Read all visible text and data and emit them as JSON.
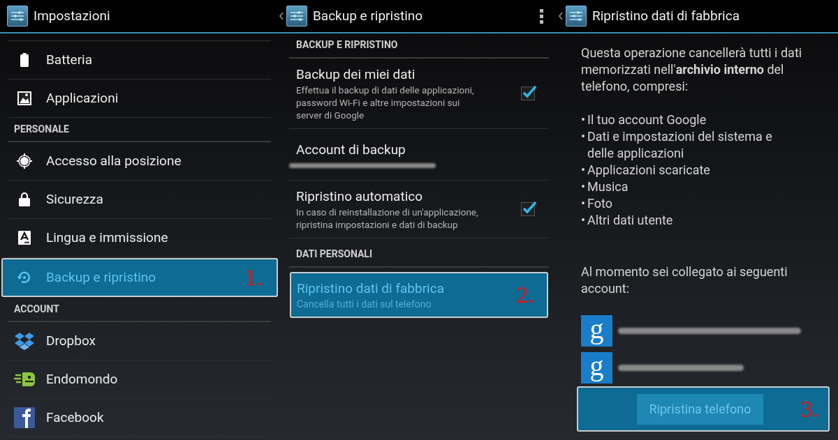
{
  "settings_panel": {
    "title": "Impostazioni",
    "back": false,
    "menu": false,
    "items": [
      {
        "kind": "item",
        "label": "Batteria",
        "selected": false
      },
      {
        "kind": "item",
        "label": "Applicazioni",
        "selected": false
      },
      {
        "kind": "header",
        "label": "PERSONALE"
      },
      {
        "kind": "item",
        "label": "Accesso alla posizione",
        "selected": false
      },
      {
        "kind": "item",
        "label": "Sicurezza",
        "selected": false
      },
      {
        "kind": "item",
        "label": "Lingua e immissione",
        "selected": false
      },
      {
        "kind": "item",
        "label": "Backup e ripristino",
        "selected": true,
        "step": "1."
      },
      {
        "kind": "header",
        "label": "ACCOUNT"
      },
      {
        "kind": "item",
        "label": "Dropbox",
        "selected": false
      },
      {
        "kind": "item",
        "label": "Endomondo",
        "selected": false
      },
      {
        "kind": "item",
        "label": "Facebook",
        "selected": false
      }
    ]
  },
  "backup_panel": {
    "title": "Backup e ripristino",
    "back": true,
    "menu": true,
    "items": [
      {
        "kind": "header",
        "label": "BACKUP E RIPRISTINO"
      },
      {
        "kind": "checkbox",
        "label": "Backup dei miei dati",
        "summary": "Effettua il backup di dati delle applicazioni, password Wi-Fi e altre impostazioni sui server di Google",
        "checked": true
      },
      {
        "kind": "account",
        "label": "Account di backup"
      },
      {
        "kind": "checkbox",
        "label": "Ripristino automatico",
        "summary": "In caso di reinstallazione di un'applicazione, ripristina impostazioni e dati di backup",
        "checked": true
      },
      {
        "kind": "header",
        "label": "DATI PERSONALI"
      },
      {
        "kind": "item",
        "label": "Ripristino dati di fabbrica",
        "summary": "Cancella tutti i dati sul telefono",
        "selected": true,
        "step": "2."
      }
    ]
  },
  "reset_panel": {
    "title": "Ripristino dati di fabbrica",
    "back": true,
    "menu": false,
    "intro": "Questa operazione cancellerà tutti i dati memorizzati nell'**archivio interno** del telefono, compresi:",
    "list": [
      {
        "bullet": "•",
        "text": "Il tuo account Google"
      },
      {
        "bullet": "•",
        "text": "Dati e impostazioni del sistema e delle applicazioni"
      },
      {
        "bullet": "•",
        "text": "Applicazioni scaricate"
      },
      {
        "bullet": "•",
        "text": "Musica"
      },
      {
        "bullet": "•",
        "text": "Foto"
      },
      {
        "bullet": "•",
        "text": "Altri dati utente"
      }
    ],
    "accounts_intro": "Al momento sei collegato ai seguenti account:",
    "accounts": [
      {
        "icon_letter": "g"
      },
      {
        "icon_letter": "g"
      }
    ],
    "button": {
      "label": "Ripristina telefono",
      "selected": true,
      "step": "3."
    }
  }
}
